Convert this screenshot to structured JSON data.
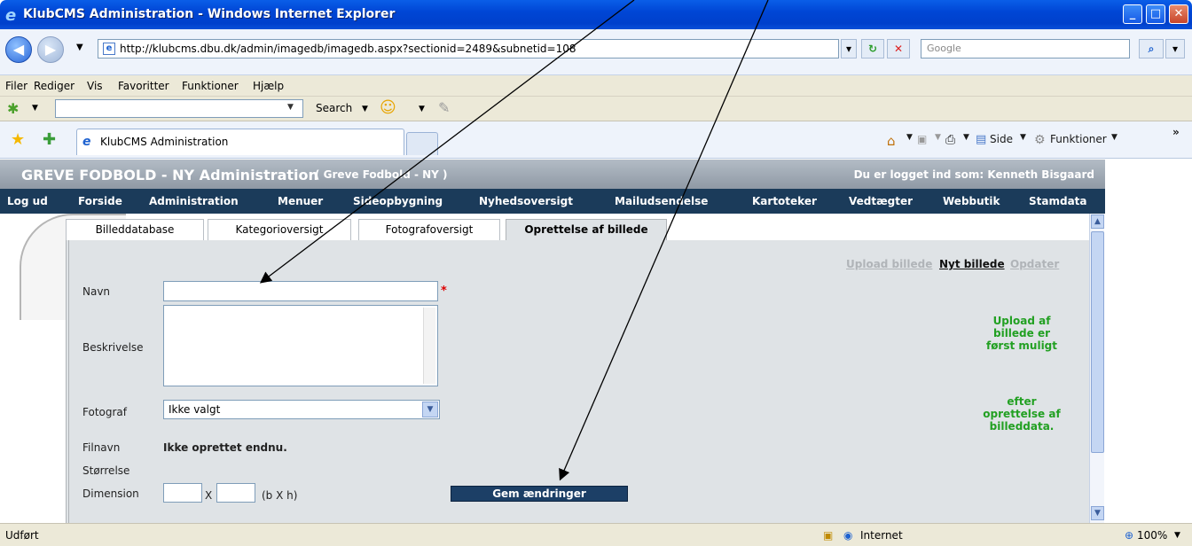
{
  "window": {
    "title": "KlubCMS Administration - Windows Internet Explorer",
    "minimize": "_",
    "maximize": "□",
    "close": "✕"
  },
  "address": {
    "url": "http://klubcms.dbu.dk/admin/imagedb/imagedb.aspx?sectionid=2489&subnetid=108",
    "search_placeholder": "Google"
  },
  "menubar": {
    "items": [
      "Filer",
      "Rediger",
      "Vis",
      "Favoritter",
      "Funktioner",
      "Hjælp"
    ]
  },
  "toolbar": {
    "search_label": "Search"
  },
  "tabbar": {
    "tab_title": "KlubCMS Administration",
    "side": "Side",
    "funktioner": "Funktioner"
  },
  "cms": {
    "header_title": "GREVE FODBOLD - NY Administration",
    "header_sub": "( Greve Fodbold - NY )",
    "logged_in": "Du er logget ind som: Kenneth Bisgaard",
    "nav": [
      "Log ud",
      "Forside",
      "Administration",
      "Menuer",
      "Sideopbygning",
      "Nyhedsoversigt",
      "Mailudsendelse",
      "Kartoteker",
      "Vedtægter",
      "Webbutik",
      "Stamdata"
    ],
    "tabs": [
      "Billeddatabase",
      "Kategorioversigt",
      "Fotografoversigt",
      "Oprettelse af billede"
    ],
    "links": {
      "upload": "Upload billede",
      "new": "Nyt billede",
      "update": "Opdater"
    },
    "form": {
      "navn_label": "Navn",
      "beskrivelse_label": "Beskrivelse",
      "fotograf_label": "Fotograf",
      "fotograf_value": "Ikke valgt",
      "filnavn_label": "Filnavn",
      "filnavn_value": "Ikke oprettet endnu.",
      "storrelse_label": "Størrelse",
      "dimension_label": "Dimension",
      "x_label": "X",
      "bxh_label": "(b X h)",
      "save_button": "Gem ændringer",
      "required_mark": "*"
    },
    "notice_1": "Upload af billede er først muligt",
    "notice_2": "efter oprettelse af billeddata."
  },
  "status": {
    "left": "Udført",
    "zone": "Internet",
    "zoom": "100%"
  },
  "colors": {
    "titlebar": "#0046d5",
    "cms_nav": "#1b3b5a",
    "notice": "#22a022",
    "save_button": "#1c3f66"
  }
}
